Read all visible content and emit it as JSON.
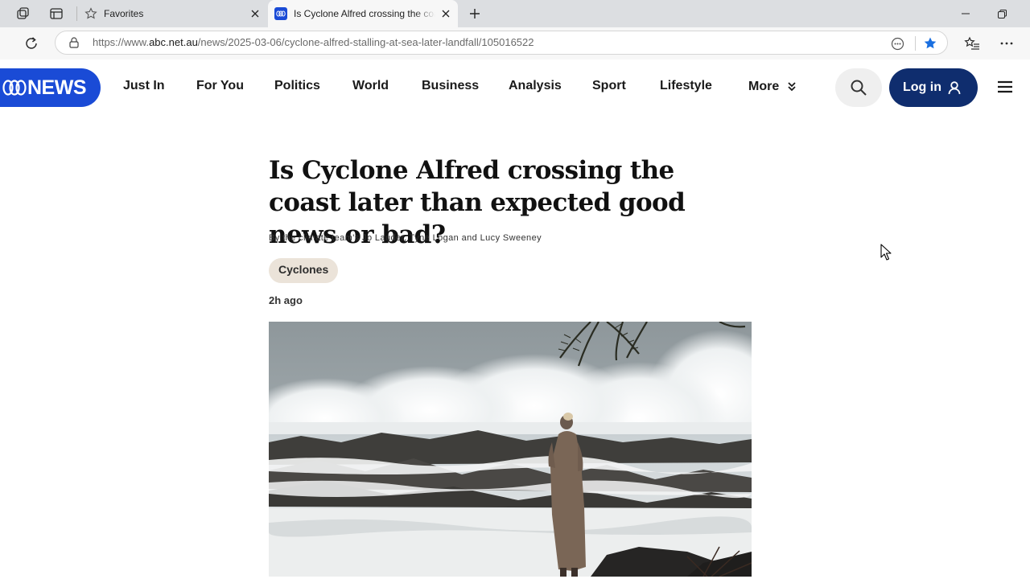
{
  "browser": {
    "tabs": [
      {
        "title": "Favorites",
        "active": false
      },
      {
        "title": "Is Cyclone Alfred crossing the coast",
        "active": true
      }
    ],
    "url_prefix": "https://www.",
    "url_domain": "abc.net.au",
    "url_path": "/news/2025-03-06/cyclone-alfred-stalling-at-sea-later-landfall/105016522",
    "favorite_star_color": "#1a6fe0"
  },
  "site": {
    "logo_text": "NEWS",
    "brand_color": "#1a4bd6",
    "nav": [
      "Just In",
      "For You",
      "Politics",
      "World",
      "Business",
      "Analysis",
      "Sport",
      "Lifestyle",
      "More"
    ],
    "login_label": "Log in",
    "login_color": "#0f2d6e"
  },
  "article": {
    "headline": "Is Cyclone Alfred crossing the coast later than expected good news or bad?",
    "byline": "By the climate team's Jo Lauder, Tyne Logan and Lucy Sweeney",
    "topic": "Cyclones",
    "timestamp": "2h ago",
    "image_description": "Woman standing on rocks watching large waves crash, palm fronds above"
  },
  "icons": [
    "workspaces-icon",
    "tab-actions-icon",
    "favorites-star-icon",
    "close-icon",
    "abc-favicon-icon",
    "new-tab-icon",
    "minimize-icon",
    "restore-icon",
    "refresh-icon",
    "lock-icon",
    "reader-icon",
    "favorite-star-icon",
    "collections-icon",
    "more-icon",
    "search-icon",
    "user-icon",
    "hamburger-menu-icon",
    "cursor-icon"
  ]
}
